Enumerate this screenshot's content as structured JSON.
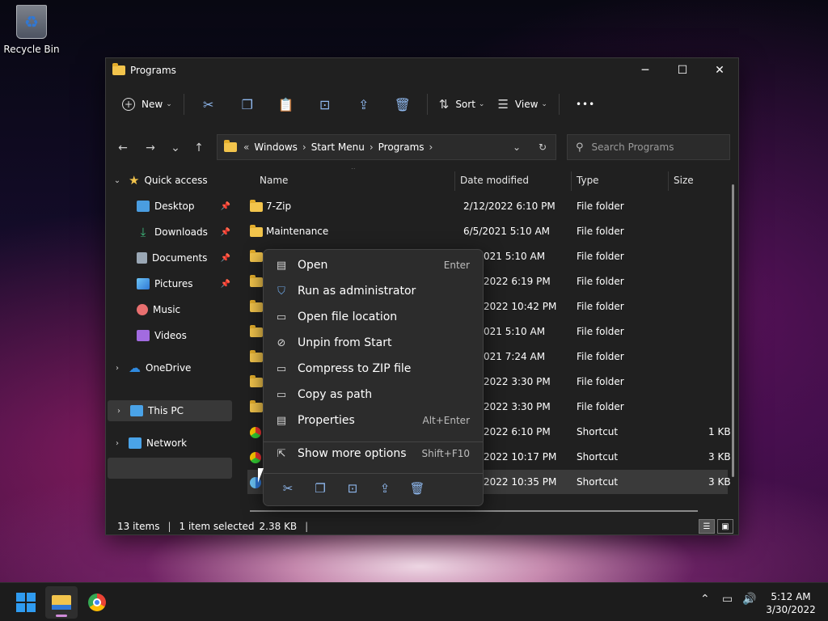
{
  "desktop": {
    "recycle_bin_label": "Recycle Bin"
  },
  "window": {
    "title": "Programs",
    "controls": {
      "minimize": "─",
      "maximize": "☐",
      "close": "✕"
    }
  },
  "toolbar": {
    "new_label": "New",
    "sort_label": "Sort",
    "view_label": "View",
    "more_label": "•••"
  },
  "address_bar": {
    "overflow": "«",
    "crumbs": [
      "Windows",
      "Start Menu",
      "Programs"
    ],
    "separator": "›"
  },
  "search": {
    "placeholder": "Search Programs"
  },
  "sidebar": {
    "items": [
      {
        "label": "Quick access",
        "icon": "star-icon",
        "color": "#f2c44c"
      },
      {
        "label": "Desktop",
        "icon": "desktop-icon",
        "color": "#4a9de0",
        "pinned": true
      },
      {
        "label": "Downloads",
        "icon": "download-icon",
        "color": "#3fbf7f",
        "pinned": true
      },
      {
        "label": "Documents",
        "icon": "document-icon",
        "color": "#9aa7b5",
        "pinned": true
      },
      {
        "label": "Pictures",
        "icon": "pictures-icon",
        "color": "#4aa3e8",
        "pinned": true
      },
      {
        "label": "Music",
        "icon": "music-icon",
        "color": "#e86f6f"
      },
      {
        "label": "Videos",
        "icon": "video-icon",
        "color": "#a26be0"
      },
      {
        "label": "OneDrive",
        "icon": "cloud-icon",
        "color": "#2f8ae0"
      },
      {
        "label": "This PC",
        "icon": "computer-icon",
        "color": "#4aa3e8"
      },
      {
        "label": "Network",
        "icon": "network-icon",
        "color": "#4aa3e8"
      }
    ]
  },
  "file_list": {
    "columns": [
      "Name",
      "Date modified",
      "Type",
      "Size"
    ],
    "rows": [
      {
        "name": "7-Zip",
        "date": "2/12/2022 6:10 PM",
        "type": "File folder",
        "size": ""
      },
      {
        "name": "Maintenance",
        "date": "6/5/2021 5:10 AM",
        "type": "File folder",
        "size": ""
      },
      {
        "name": "",
        "date": "021 5:10 AM",
        "type": "File folder",
        "size": ""
      },
      {
        "name": "",
        "date": "2022 6:19 PM",
        "type": "File folder",
        "size": ""
      },
      {
        "name": "",
        "date": "2022 10:42 PM",
        "type": "File folder",
        "size": ""
      },
      {
        "name": "",
        "date": "021 5:10 AM",
        "type": "File folder",
        "size": ""
      },
      {
        "name": "",
        "date": "021 7:24 AM",
        "type": "File folder",
        "size": ""
      },
      {
        "name": "",
        "date": "2022 3:30 PM",
        "type": "File folder",
        "size": ""
      },
      {
        "name": "",
        "date": "2022 3:30 PM",
        "type": "File folder",
        "size": ""
      },
      {
        "name": "",
        "date": "2022 6:10 PM",
        "type": "Shortcut",
        "size": "1 KB"
      },
      {
        "name": "",
        "date": "2022 10:17 PM",
        "type": "Shortcut",
        "size": "3 KB"
      },
      {
        "name": "",
        "date": "2022 10:35 PM",
        "type": "Shortcut",
        "size": "3 KB"
      }
    ]
  },
  "status_bar": {
    "item_count": "13 items",
    "selection": "1 item selected",
    "selection_size": "2.38 KB"
  },
  "context_menu": {
    "items": [
      {
        "label": "Open",
        "shortcut": "Enter",
        "icon": "open-icon"
      },
      {
        "label": "Run as administrator",
        "shortcut": "",
        "icon": "shield-icon"
      },
      {
        "label": "Open file location",
        "shortcut": "",
        "icon": "folder-icon"
      },
      {
        "label": "Unpin from Start",
        "shortcut": "",
        "icon": "unpin-icon"
      },
      {
        "label": "Compress to ZIP file",
        "shortcut": "",
        "icon": "zip-icon"
      },
      {
        "label": "Copy as path",
        "shortcut": "",
        "icon": "path-icon"
      },
      {
        "label": "Properties",
        "shortcut": "Alt+Enter",
        "icon": "properties-icon"
      },
      {
        "label": "Show more options",
        "shortcut": "Shift+F10",
        "icon": "more-options-icon"
      }
    ]
  },
  "taskbar": {
    "time": "5:12 AM",
    "date": "3/30/2022"
  },
  "colors": {
    "accent": "#8fb8ee",
    "folder": "#f2c44c",
    "window_bg": "#202020"
  }
}
